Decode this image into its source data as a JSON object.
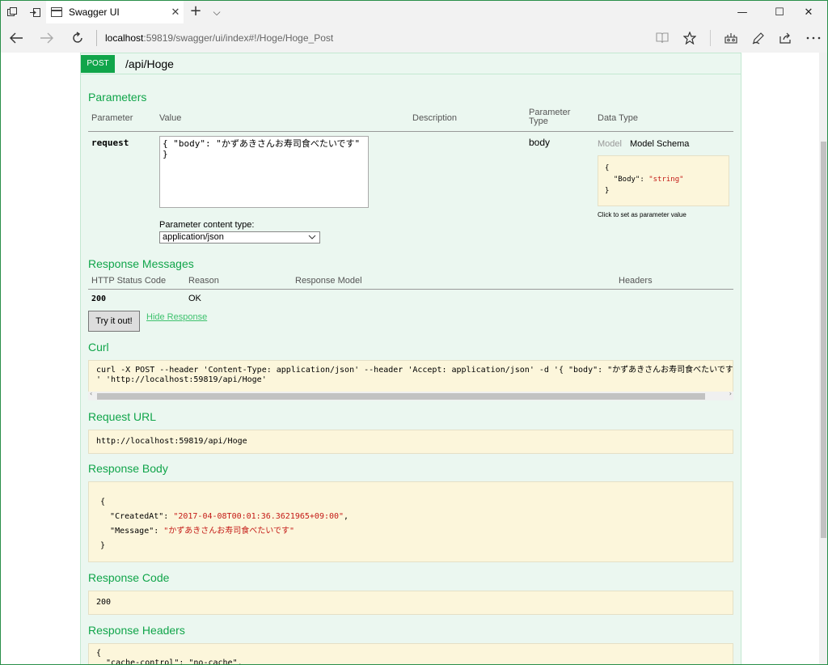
{
  "window": {
    "tab_title": "Swagger UI",
    "tab_close": "✕",
    "new_tab": "+",
    "tab_list": "⌵",
    "minimize": "—",
    "maximize": "☐",
    "close": "✕"
  },
  "navbar": {
    "url_host": "localhost",
    "url_rest": ":59819/swagger/ui/index#!/Hoge/Hoge_Post"
  },
  "operation": {
    "method": "POST",
    "path": "/api/Hoge"
  },
  "parameters": {
    "title": "Parameters",
    "columns": {
      "parameter": "Parameter",
      "value": "Value",
      "description": "Description",
      "type_line1": "Parameter",
      "type_line2": "Type",
      "data_type": "Data Type"
    },
    "row": {
      "name": "request",
      "value": "{ \"body\": \"かずあきさんお寿司食べたいです\" }",
      "type": "body",
      "model_tab": "Model",
      "schema_tab": "Model Schema",
      "schema_open": "{",
      "schema_key": "\"Body\"",
      "schema_colon": ": ",
      "schema_value": "\"string\"",
      "schema_close": "}",
      "click_hint": "Click to set as parameter value"
    },
    "content_type_label": "Parameter content type:",
    "content_type_value": "application/json"
  },
  "response_messages": {
    "title": "Response Messages",
    "columns": {
      "status": "HTTP Status Code",
      "reason": "Reason",
      "model": "Response Model",
      "headers": "Headers"
    },
    "row": {
      "code": "200",
      "reason": "OK"
    }
  },
  "actions": {
    "try_it": "Try it out!",
    "hide_response": "Hide Response"
  },
  "curl": {
    "title": "Curl",
    "line1": "curl -X POST --header 'Content-Type: application/json' --header 'Accept: application/json' -d '{ \"body\": \"かずあきさんお寿司食べたいです\" }'",
    "line2": "' 'http://localhost:59819/api/Hoge'"
  },
  "request_url": {
    "title": "Request URL",
    "value": "http://localhost:59819/api/Hoge"
  },
  "response_body": {
    "title": "Response Body",
    "open": "{",
    "k1": "\"CreatedAt\"",
    "v1": "\"2017-04-08T00:01:36.3621965+09:00\"",
    "k2": "\"Message\"",
    "v2": "\"かずあきさんお寿司食べたいです\"",
    "close": "}"
  },
  "response_code": {
    "title": "Response Code",
    "value": "200"
  },
  "response_headers": {
    "title": "Response Headers",
    "line1": "{",
    "line2": "  \"cache-control\": \"no-cache\","
  }
}
